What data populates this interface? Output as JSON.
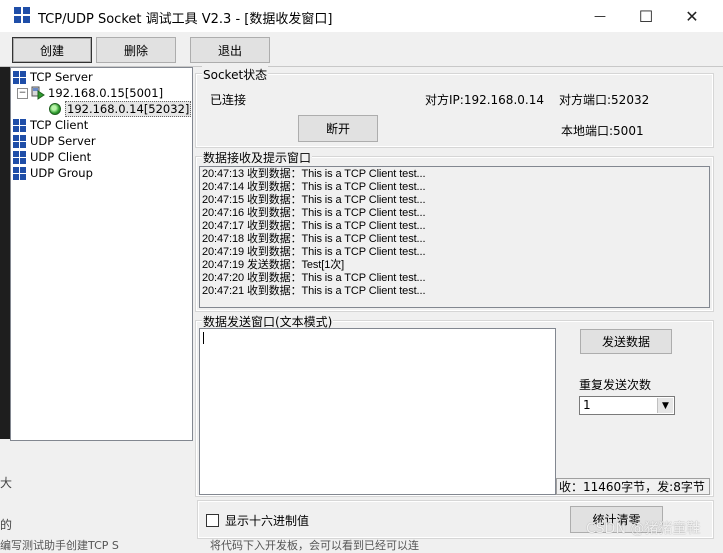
{
  "window": {
    "title": "TCP/UDP Socket 调试工具 V2.3 - [数据收发窗口]",
    "minimize": "—",
    "maximize": "☐",
    "close": "✕"
  },
  "toolbar": {
    "create": "创建",
    "delete": "删除",
    "exit": "退出"
  },
  "tree": {
    "tcp_server": "TCP Server",
    "server_node": "192.168.0.15[5001]",
    "client_node": "192.168.0.14[52032]",
    "tcp_client": "TCP Client",
    "udp_server": "UDP Server",
    "udp_client": "UDP Client",
    "udp_group": "UDP Group",
    "expander": "−"
  },
  "socket": {
    "group_title": "Socket状态",
    "status": "已连接",
    "remote_ip": "对方IP:192.168.0.14",
    "remote_port": "对方端口:52032",
    "disconnect": "断开",
    "local_port": "本地端口:5001"
  },
  "receive": {
    "group_title": "数据接收及提示窗口",
    "lines": [
      "20:47:13 收到数据：This is a TCP Client test...",
      "20:47:14 收到数据：This is a TCP Client test...",
      "20:47:15 收到数据：This is a TCP Client test...",
      "20:47:16 收到数据：This is a TCP Client test...",
      "20:47:17 收到数据：This is a TCP Client test...",
      "20:47:18 收到数据：This is a TCP Client test...",
      "20:47:19 收到数据：This is a TCP Client test...",
      "20:47:19 发送数据：Test[1次]",
      "20:47:20 收到数据：This is a TCP Client test...",
      "20:47:21 收到数据：This is a TCP Client test..."
    ]
  },
  "send": {
    "group_title": "数据发送窗口(文本模式)",
    "text": "",
    "send_button": "发送数据",
    "repeat_label": "重复发送次数",
    "repeat_value": "1",
    "stats": "收：11460字节，发:8字节",
    "hex_checkbox": "显示十六进制值",
    "hex_checked": false,
    "clear_stats": "统计清零"
  },
  "watermark": "CSDN @猪猪童鞋",
  "background": {
    "fragments": [
      "大",
      "的",
      "编写测试助手创建TCP  S",
      "将代码下入开发板，会可以看到已经可以连"
    ]
  }
}
